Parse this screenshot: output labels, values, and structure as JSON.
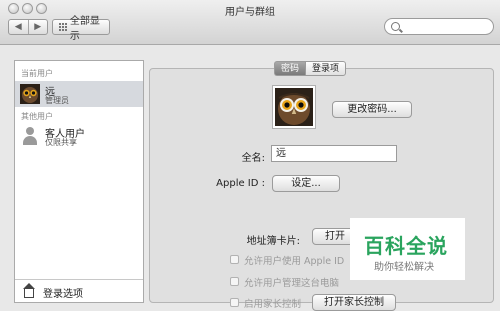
{
  "window": {
    "title": "用户与群组",
    "show_all": "全部显示",
    "nav_back": "◀",
    "nav_forward": "▶"
  },
  "sidebar": {
    "current_users_header": "当前用户",
    "current_user": {
      "name": "远",
      "role": "管理员"
    },
    "other_users_header": "其他用户",
    "guest_user": {
      "name": "客人用户",
      "role": "仅限共享"
    },
    "login_options": "登录选项"
  },
  "tabs": {
    "password": "密码",
    "login_items": "登录项",
    "selected": "密码"
  },
  "form": {
    "change_password_button": "更改密码...",
    "full_name_label": "全名:",
    "full_name_value": "远",
    "apple_id_label": "Apple ID :",
    "apple_id_button": "设定...",
    "address_card_label": "地址簿卡片:",
    "address_card_button": "打开",
    "checkbox1_label": "允许用户使用 Apple ID",
    "checkbox2_label": "允许用户管理这台电脑",
    "checkbox3_label": "启用家长控制",
    "parental_button": "打开家长控制"
  },
  "watermark": {
    "logo": "百科全说",
    "tagline": "助你轻松解决"
  },
  "colors": {
    "watermark_green": "#2aa45e",
    "selection": "#d6d9de"
  }
}
